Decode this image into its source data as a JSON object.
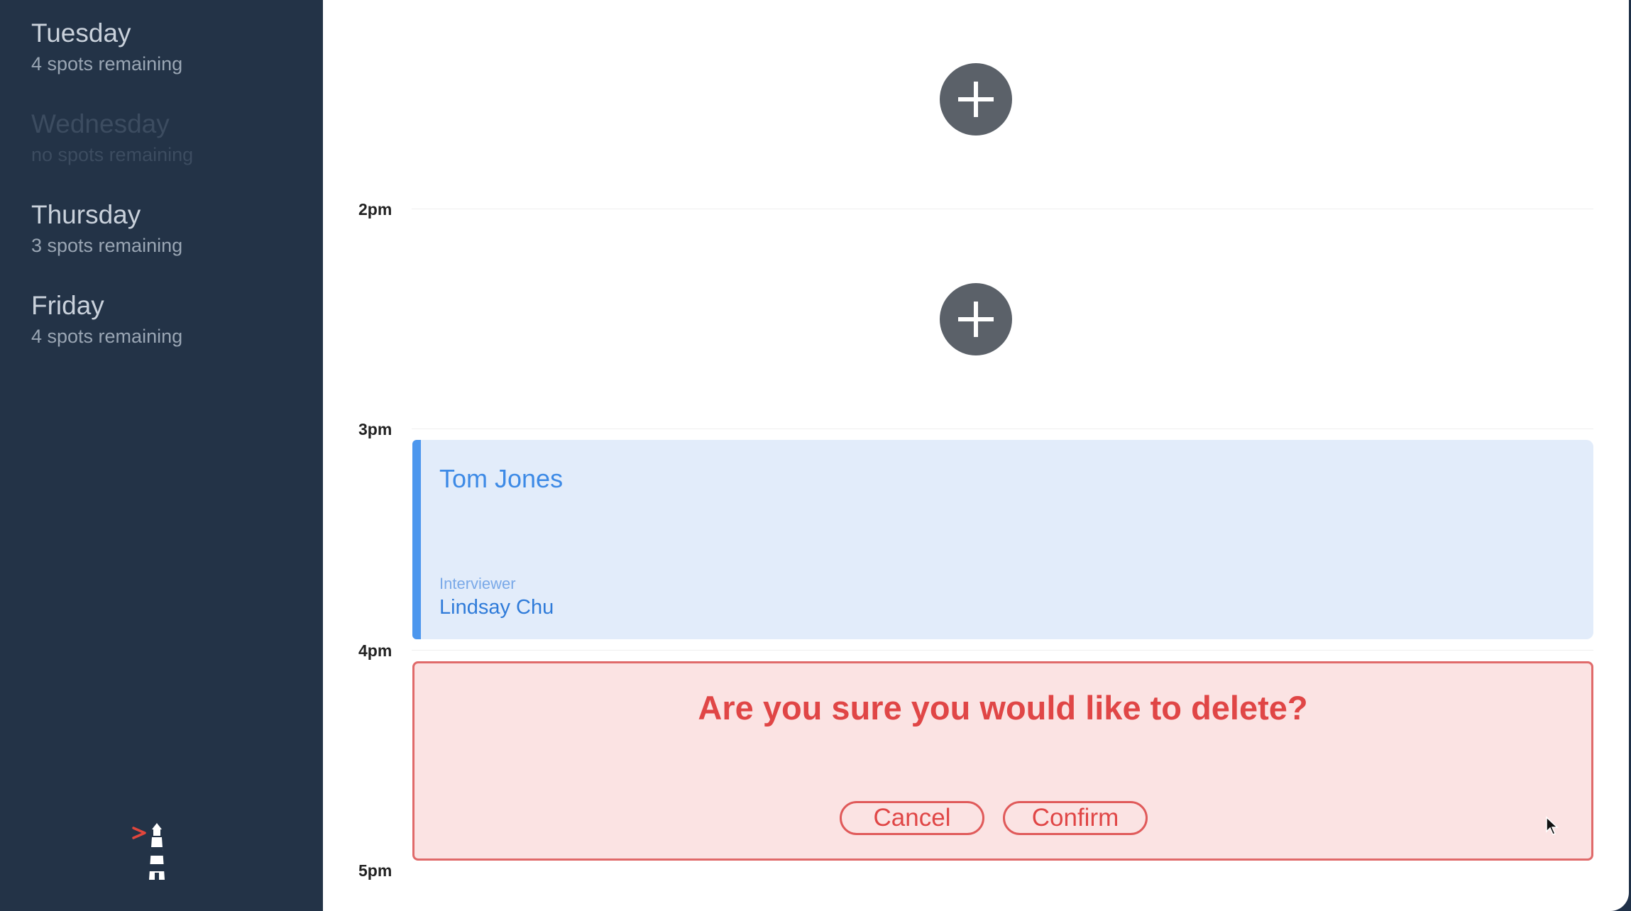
{
  "sidebar": {
    "days": [
      {
        "name": "Tuesday",
        "spots": "4 spots remaining"
      },
      {
        "name": "Wednesday",
        "spots": "no spots remaining"
      },
      {
        "name": "Thursday",
        "spots": "3 spots remaining"
      },
      {
        "name": "Friday",
        "spots": "4 spots remaining"
      }
    ],
    "logo_icon": "lighthouse-icon"
  },
  "schedule": {
    "times": [
      "2pm",
      "3pm",
      "4pm",
      "5pm"
    ],
    "add_icon": "plus-icon",
    "appointment": {
      "student": "Tom Jones",
      "interviewer_label": "Interviewer",
      "interviewer": "Lindsay Chu"
    },
    "confirm": {
      "message": "Are you sure you would like to delete?",
      "cancel_label": "Cancel",
      "confirm_label": "Confirm"
    }
  },
  "colors": {
    "sidebar_bg": "#233347",
    "appointment_bg": "#e2ecfa",
    "appointment_accent": "#4c97ee",
    "danger": "#e04646",
    "danger_bg": "#fbe3e3",
    "add_button": "#5b6169"
  }
}
